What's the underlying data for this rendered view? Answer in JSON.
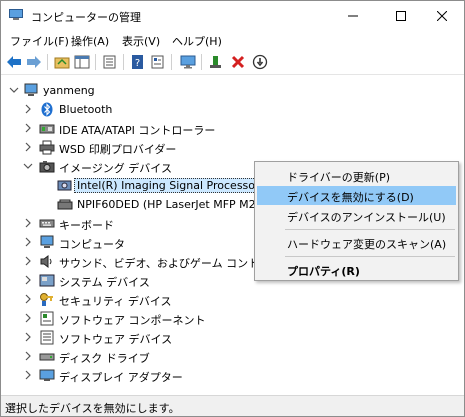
{
  "window": {
    "title": "コンピューターの管理",
    "controls": {
      "minimize": "—",
      "maximize": "☐",
      "close": "✕"
    }
  },
  "menubar": {
    "items": [
      "ファイル(F)",
      "操作(A)",
      "表示(V)",
      "ヘルプ(H)"
    ]
  },
  "toolbar": {
    "icons": [
      "back-arrow-icon",
      "forward-arrow-icon",
      "folder-up-icon",
      "console-tree-icon",
      "export-list-icon",
      "help-icon",
      "properties-icon",
      "monitor-icon",
      "update-driver-icon",
      "uninstall-x-icon",
      "disable-device-icon"
    ]
  },
  "tree": {
    "root": "yanmeng",
    "nodes": [
      {
        "label": "Bluetooth",
        "icon": "bluetooth-icon",
        "expanded": false
      },
      {
        "label": "IDE ATA/ATAPI コントローラー",
        "icon": "ide-controller-icon",
        "expanded": false
      },
      {
        "label": "WSD 印刷プロバイダー",
        "icon": "printer-provider-icon",
        "expanded": false
      },
      {
        "label": "イメージング デバイス",
        "icon": "camera-icon",
        "expanded": true,
        "children": [
          {
            "label": "Intel(R) Imaging Signal Processor 2300",
            "icon": "imaging-device-icon",
            "selected": true
          },
          {
            "label": "NPIF60DED (HP LaserJet MFP M234sdw)",
            "icon": "scanner-icon",
            "selected": false
          }
        ]
      },
      {
        "label": "キーボード",
        "icon": "keyboard-icon",
        "expanded": false
      },
      {
        "label": "コンピュータ",
        "icon": "computer-icon",
        "expanded": false
      },
      {
        "label": "サウンド、ビデオ、およびゲーム コントローラー",
        "icon": "speaker-icon",
        "expanded": false
      },
      {
        "label": "システム デバイス",
        "icon": "system-device-icon",
        "expanded": false
      },
      {
        "label": "セキュリティ デバイス",
        "icon": "security-key-icon",
        "expanded": false
      },
      {
        "label": "ソフトウェア コンポーネント",
        "icon": "software-component-icon",
        "expanded": false
      },
      {
        "label": "ソフトウェア デバイス",
        "icon": "software-device-icon",
        "expanded": false
      },
      {
        "label": "ディスク ドライブ",
        "icon": "disk-drive-icon",
        "expanded": false
      },
      {
        "label": "ディスプレイ アダプター",
        "icon": "display-adapter-icon",
        "expanded": false
      }
    ]
  },
  "context_menu": {
    "items": [
      {
        "label": "ドライバーの更新(P)",
        "highlighted": false,
        "bold": false
      },
      {
        "label": "デバイスを無効にする(D)",
        "highlighted": true,
        "bold": false
      },
      {
        "label": "デバイスのアンインストール(U)",
        "highlighted": false,
        "bold": false
      },
      {
        "label": "ハードウェア変更のスキャン(A)",
        "highlighted": false,
        "bold": false
      },
      {
        "label": "プロパティ(R)",
        "highlighted": false,
        "bold": true
      }
    ]
  },
  "statusbar": {
    "text": "選択したデバイスを無効にします。"
  },
  "colors": {
    "highlight": "#91c9f7",
    "selection": "#cce8ff",
    "accent_blue": "#1e72c7",
    "error_red": "#d42020"
  }
}
